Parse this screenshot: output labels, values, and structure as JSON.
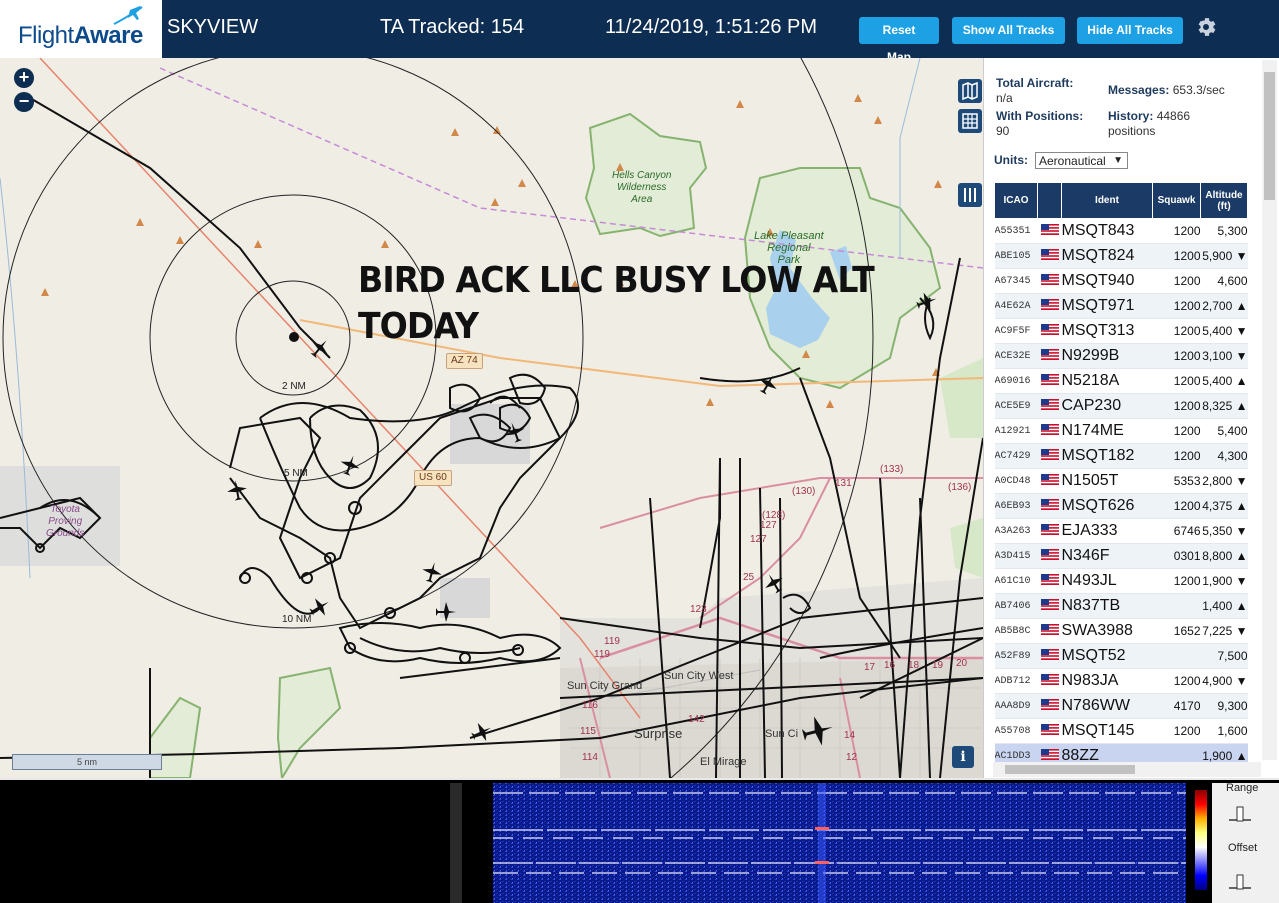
{
  "header": {
    "logo_text_a": "Flight",
    "logo_text_b": "Aware",
    "site_name": "SKYVIEW",
    "tracked": "TA Tracked: 154",
    "datetime": "11/24/2019, 1:51:26 PM",
    "buttons": {
      "reset_map": "Reset Map",
      "show_all": "Show All Tracks",
      "hide_all": "Hide All Tracks"
    },
    "icons": {
      "settings": "gear-icon"
    },
    "colors": {
      "bar": "#0d2d52",
      "button": "#1ea1e4"
    }
  },
  "map": {
    "zoom_in": "+",
    "zoom_out": "−",
    "overlay_line1": "BIRD ACK LLC BUSY LOW ALT",
    "overlay_line2": "TODAY",
    "scale": "5 nm",
    "info": "i",
    "rings": {
      "r2": "2 NM",
      "r5": "5 NM",
      "r10": "10 NM"
    },
    "places": {
      "hells_canyon": "Hells Canyon Wilderness Area",
      "hells_l1": "Hells Canyon",
      "hells_l2": "Wilderness",
      "hells_l3": "Area",
      "lake_l1": "Lake Pleasant",
      "lake_l2": "Regional",
      "lake_l3": "Park",
      "toyota_l1": "Toyota",
      "toyota_l2": "Proving",
      "toyota_l3": "Grounds",
      "sun_city_grand": "Sun City Grand",
      "sun_city_west": "Sun City West",
      "surprise": "Surprise",
      "sun_city": "Sun Ci",
      "el_mirage": "El Mirage"
    },
    "roads": {
      "az74": "AZ 74",
      "us60": "US 60",
      "r131": "131",
      "r130": "(130)",
      "r133": "(133)",
      "r136": "(136)",
      "r128": "(128)",
      "r127a": "127",
      "r127b": "127",
      "r125": "25",
      "r123": "123",
      "r119a": "119",
      "r119b": "119",
      "r116": "116",
      "r115": "115",
      "r114": "114",
      "r142": "142",
      "r17": "17",
      "r16": "16",
      "r18": "18",
      "r19": "19",
      "r20": "20",
      "r14": "14",
      "r12": "12"
    }
  },
  "sidebar": {
    "total_aircraft_label": "Total Aircraft:",
    "total_aircraft_value": "n/a",
    "messages_label": "Messages:",
    "messages_value": "653.3/sec",
    "with_positions_label": "With Positions:",
    "with_positions_value": "90",
    "history_label": "History:",
    "history_value": "44866",
    "history_unit": "positions",
    "units_label": "Units:",
    "units_value": "Aeronautical",
    "columns": {
      "icao": "ICAO",
      "ident": "Ident",
      "squawk": "Squawk",
      "alt_l1": "Altitude",
      "alt_l2": "(ft)"
    },
    "rows": [
      {
        "icao": "A55351",
        "ident": "MSQT843",
        "squawk": "1200",
        "alt": "5,300"
      },
      {
        "icao": "ABE105",
        "ident": "MSQT824",
        "squawk": "1200",
        "alt": "5,900 ▼"
      },
      {
        "icao": "A67345",
        "ident": "MSQT940",
        "squawk": "1200",
        "alt": "4,600"
      },
      {
        "icao": "A4E62A",
        "ident": "MSQT971",
        "squawk": "1200",
        "alt": "2,700 ▲"
      },
      {
        "icao": "AC9F5F",
        "ident": "MSQT313",
        "squawk": "1200",
        "alt": "5,400 ▼"
      },
      {
        "icao": "ACE32E",
        "ident": "N9299B",
        "squawk": "1200",
        "alt": "3,100 ▼"
      },
      {
        "icao": "A69016",
        "ident": "N5218A",
        "squawk": "1200",
        "alt": "5,400 ▲"
      },
      {
        "icao": "ACE5E9",
        "ident": "CAP230",
        "squawk": "1200",
        "alt": "8,325 ▲"
      },
      {
        "icao": "A12921",
        "ident": "N174ME",
        "squawk": "1200",
        "alt": "5,400"
      },
      {
        "icao": "AC7429",
        "ident": "MSQT182",
        "squawk": "1200",
        "alt": "4,300"
      },
      {
        "icao": "A0CD48",
        "ident": "N1505T",
        "squawk": "5353",
        "alt": "2,800 ▼"
      },
      {
        "icao": "A6EB93",
        "ident": "MSQT626",
        "squawk": "1200",
        "alt": "4,375 ▲"
      },
      {
        "icao": "A3A263",
        "ident": "EJA333",
        "squawk": "6746",
        "alt": "5,350 ▼"
      },
      {
        "icao": "A3D415",
        "ident": "N346F",
        "squawk": "0301",
        "alt": "8,800 ▲"
      },
      {
        "icao": "A61C10",
        "ident": "N493JL",
        "squawk": "1200",
        "alt": "1,900 ▼"
      },
      {
        "icao": "AB7406",
        "ident": "N837TB",
        "squawk": "",
        "alt": "1,400 ▲"
      },
      {
        "icao": "AB5B8C",
        "ident": "SWA3988",
        "squawk": "1652",
        "alt": "7,225 ▼"
      },
      {
        "icao": "A52F89",
        "ident": "MSQT52",
        "squawk": "",
        "alt": "7,500"
      },
      {
        "icao": "ADB712",
        "ident": "N983JA",
        "squawk": "1200",
        "alt": "4,900 ▼"
      },
      {
        "icao": "AAA8D9",
        "ident": "N786WW",
        "squawk": "4170",
        "alt": "9,300"
      },
      {
        "icao": "A55708",
        "ident": "MSQT145",
        "squawk": "1200",
        "alt": "1,600"
      },
      {
        "icao": "AC1DD3",
        "ident": "88ZZ",
        "squawk": "",
        "alt": "1,900 ▲",
        "selected": true
      }
    ]
  },
  "bottom": {
    "range_label": "Range",
    "offset_label": "Offset"
  }
}
